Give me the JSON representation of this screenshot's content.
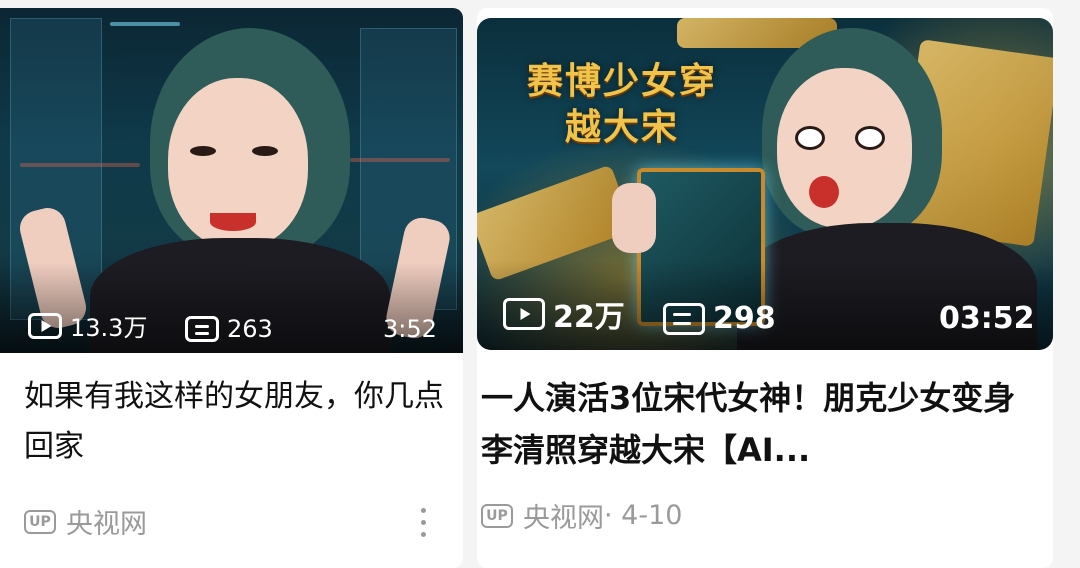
{
  "cards": [
    {
      "views": "13.3万",
      "comments": "263",
      "duration": "3:52",
      "title": "如果有我这样的女朋友，你几点回家",
      "author": "央视网",
      "up_badge": "UP",
      "icons": [
        "play-icon",
        "comment-icon",
        "more-icon"
      ]
    },
    {
      "thumbnail_title": "赛博少女穿越大宋",
      "views": "22万",
      "comments": "298",
      "duration": "03:52",
      "title": "一人演活3位宋代女神！朋克少女变身李清照穿越大宋【AI...",
      "author": "央视网",
      "date": "· 4-10",
      "up_badge": "UP",
      "icons": [
        "play-icon",
        "comment-icon"
      ]
    }
  ]
}
